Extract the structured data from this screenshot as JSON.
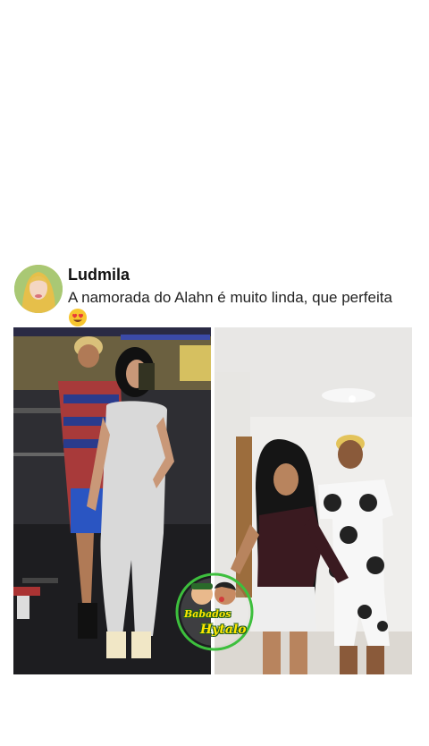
{
  "post": {
    "author": "Ludmila",
    "caption": "A namorada do Alahn é muito linda, que perfeita",
    "emoji_icon": "heart-eyes-emoji-icon"
  },
  "media": {
    "left_photo_icon": "gym-mirror-selfie-photo",
    "right_photo_icon": "couple-dancing-photo"
  },
  "watermark": {
    "line1": "Babados",
    "line2": "Hytalo"
  },
  "colors": {
    "background": "#ffffff",
    "watermark_ring": "#3dbf3d",
    "watermark_text": "#ffe600"
  }
}
